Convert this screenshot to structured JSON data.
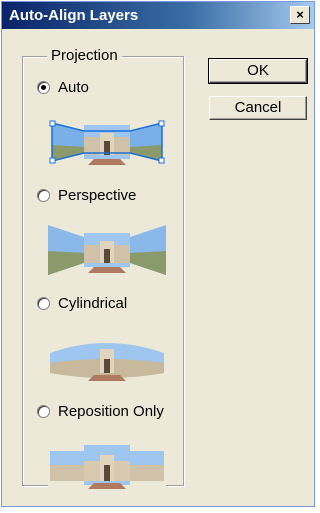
{
  "window": {
    "title": "Auto-Align Layers",
    "close_glyph": "×"
  },
  "projection": {
    "legend": "Projection",
    "options": [
      {
        "label": "Auto",
        "selected": true
      },
      {
        "label": "Perspective",
        "selected": false
      },
      {
        "label": "Cylindrical",
        "selected": false
      },
      {
        "label": "Reposition Only",
        "selected": false
      }
    ]
  },
  "buttons": {
    "ok": "OK",
    "cancel": "Cancel"
  }
}
